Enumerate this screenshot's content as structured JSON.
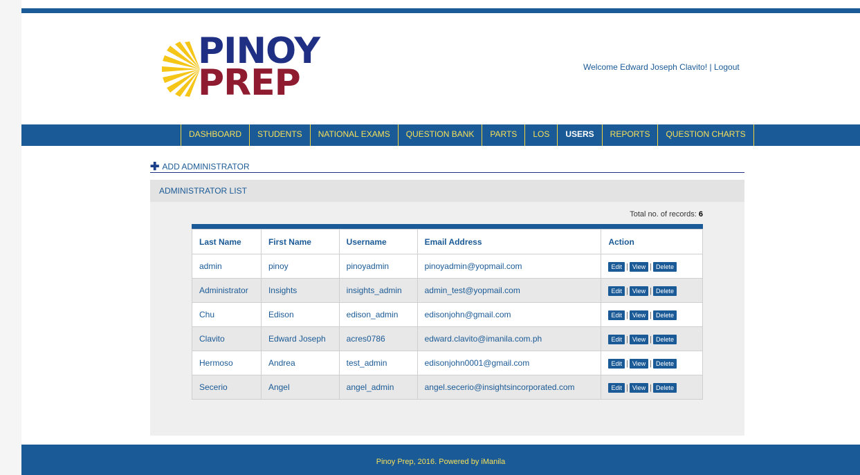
{
  "logo": {
    "line1": "PINOY",
    "line2": "PREP"
  },
  "header": {
    "welcome": "Welcome Edward Joseph Clavito! |",
    "logout": "Logout"
  },
  "nav": [
    "DASHBOARD",
    "STUDENTS",
    "NATIONAL EXAMS",
    "QUESTION BANK",
    "PARTS",
    "LOS",
    "USERS",
    "REPORTS",
    "QUESTION CHARTS"
  ],
  "active_nav": "USERS",
  "add_admin": "ADD ADMINISTRATOR",
  "panel": {
    "title": "ADMINISTRATOR LIST",
    "total_label": "Total no. of records:",
    "total_value": "6"
  },
  "table": {
    "headers": [
      "Last Name",
      "First Name",
      "Username",
      "Email Address",
      "Action"
    ],
    "rows": [
      [
        "admin",
        "pinoy",
        "pinoyadmin",
        "pinoyadmin@yopmail.com"
      ],
      [
        "Administrator",
        "Insights",
        "insights_admin",
        "admin_test@yopmail.com"
      ],
      [
        "Chu",
        "Edison",
        "edison_admin",
        "edisonjohn@gmail.com"
      ],
      [
        "Clavito",
        "Edward Joseph",
        "acres0786",
        "edward.clavito@imanila.com.ph"
      ],
      [
        "Hermoso",
        "Andrea",
        "test_admin",
        "edisonjohn0001@gmail.com"
      ],
      [
        "Secerio",
        "Angel",
        "angel_admin",
        "angel.secerio@insightsincorporated.com"
      ]
    ],
    "actions": [
      "Edit",
      "View",
      "Delete"
    ]
  },
  "footer": "Pinoy Prep, 2016. Powered by iManila",
  "colors": {
    "primary": "#1a5a96",
    "nav_text": "#f5e05a",
    "logo_blue": "#1f2f83",
    "logo_red": "#8e1b2f",
    "sun": "#f5c518"
  }
}
